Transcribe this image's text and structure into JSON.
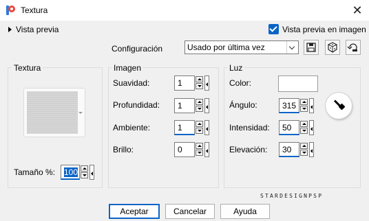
{
  "window": {
    "title": "Textura",
    "close_icon": "close-icon"
  },
  "preview": {
    "label": "Vista previa",
    "image_preview_label": "Vista previa en imagen",
    "image_preview_checked": true
  },
  "configuration": {
    "label": "Configuración",
    "selected": "Usado por última vez",
    "tools": [
      "save-preset-icon",
      "randomize-icon",
      "reset-icon"
    ]
  },
  "textura": {
    "title": "Textura",
    "size_label": "Tamaño %:",
    "size_value": "100"
  },
  "imagen": {
    "title": "Imagen",
    "fields": [
      {
        "label": "Suavidad:",
        "value": "1"
      },
      {
        "label": "Profundidad:",
        "value": "1"
      },
      {
        "label": "Ambiente:",
        "value": "1"
      },
      {
        "label": "Brillo:",
        "value": "0"
      }
    ]
  },
  "luz": {
    "title": "Luz",
    "color_label": "Color:",
    "color_value": "#ffffff",
    "fields": [
      {
        "label": "Ángulo:",
        "value": "315"
      },
      {
        "label": "Intensidad:",
        "value": "50"
      },
      {
        "label": "Elevación:",
        "value": "30"
      }
    ]
  },
  "watermark": "STARDESIGNPSP",
  "buttons": {
    "accept": "Aceptar",
    "cancel": "Cancelar",
    "help": "Ayuda"
  },
  "colors": {
    "accent": "#0a64c8",
    "background": "#f0f0f0"
  }
}
